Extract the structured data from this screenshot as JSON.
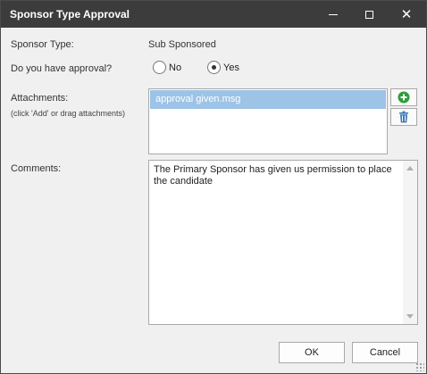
{
  "window": {
    "title": "Sponsor Type Approval",
    "close_glyph": "✕"
  },
  "form": {
    "sponsor_type_label": "Sponsor Type:",
    "sponsor_type_value": "Sub Sponsored",
    "approval_label": "Do you have approval?",
    "approval_options": [
      {
        "label": "No",
        "selected": false
      },
      {
        "label": "Yes",
        "selected": true
      }
    ],
    "attachments_label": "Attachments:",
    "attachments_hint": "(click 'Add' or drag attachments)",
    "attachments": [
      "approval given.msg"
    ],
    "comments_label": "Comments:",
    "comments_text": "The Primary Sponsor has given us permission to place the candidate"
  },
  "buttons": {
    "ok_label": "OK",
    "cancel_label": "Cancel"
  },
  "icons": {
    "add": "add-icon",
    "delete": "trash-icon"
  },
  "colors": {
    "titlebar": "#3c3c3c",
    "selection": "#9dc3e6",
    "add_icon": "#2e9e3c",
    "trash_icon": "#3a78b8"
  }
}
